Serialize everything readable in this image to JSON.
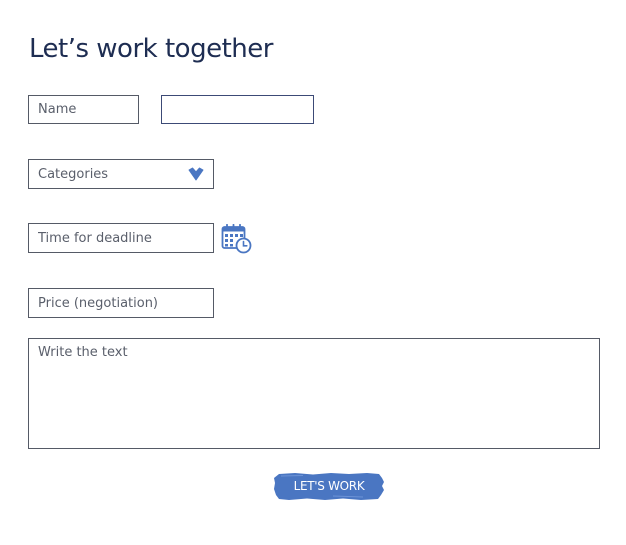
{
  "form": {
    "title": "Let’s work together",
    "name_placeholder": "Name",
    "second_placeholder": "",
    "categories_value": "Categories",
    "deadline_placeholder": "Time for deadline",
    "price_placeholder": "Price (negotiation)",
    "message_placeholder": "Write the text",
    "submit_label": "LET'S WORK"
  },
  "icons": {
    "categories_toggle": "chevron-down-icon",
    "deadline_picker": "calendar-clock-icon"
  },
  "colors": {
    "heading": "#1e2d52",
    "accent": "#4a76c2",
    "field_border": "#555a66",
    "placeholder": "#5a5f6b"
  }
}
